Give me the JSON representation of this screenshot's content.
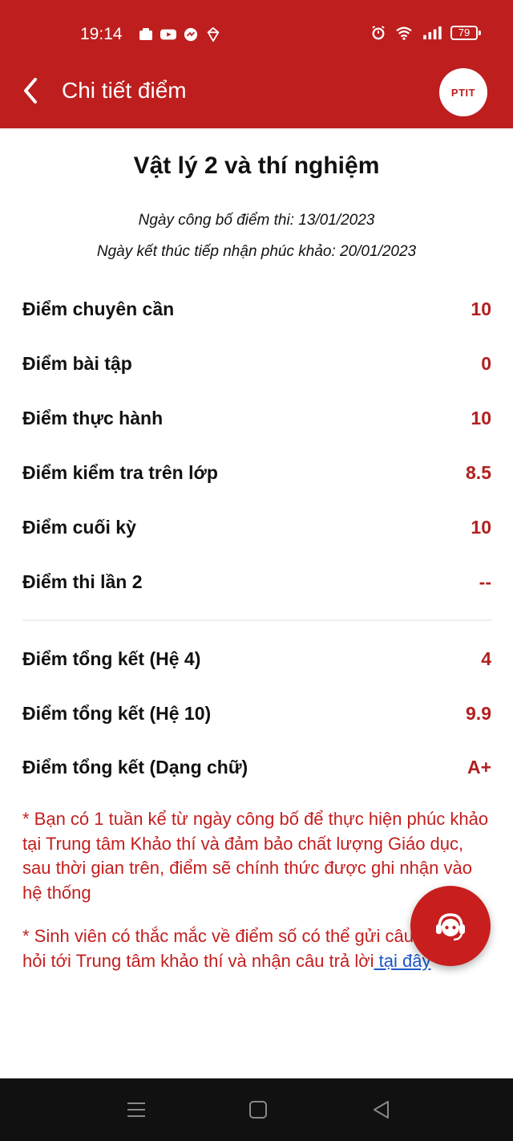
{
  "status_bar": {
    "time": "19:14",
    "left_icons": [
      "notification-icon",
      "youtube-icon",
      "messenger-icon",
      "app-icon"
    ],
    "right_icons": [
      "alarm-icon",
      "wifi-icon",
      "signal-icon"
    ],
    "battery": "79"
  },
  "header": {
    "title": "Chi tiết điểm",
    "logo_text": "PTIT",
    "background": "#be1e1e"
  },
  "subject": {
    "name": "Vật lý 2 và thí nghiệm",
    "announce_date": "Ngày công bố điểm thi: 13/01/2023",
    "appeal_end_date": "Ngày kết thúc tiếp nhận phúc khảo: 20/01/2023"
  },
  "scores": [
    {
      "label": "Điểm chuyên cần",
      "value": "10"
    },
    {
      "label": "Điểm bài tập",
      "value": "0"
    },
    {
      "label": "Điểm thực hành",
      "value": "10"
    },
    {
      "label": "Điểm kiểm tra trên lớp",
      "value": "8.5"
    },
    {
      "label": "Điểm cuối kỳ",
      "value": "10"
    },
    {
      "label": "Điểm thi lần 2",
      "value": "--"
    }
  ],
  "totals": [
    {
      "label": "Điểm tổng kết (Hệ 4)",
      "value": "4"
    },
    {
      "label": "Điểm tổng kết (Hệ 10)",
      "value": "9.9"
    },
    {
      "label": "Điểm tổng kết (Dạng chữ)",
      "value": "A+"
    }
  ],
  "notes": {
    "note1": "* Bạn có 1 tuần kể từ ngày công bố để thực hiện phúc khảo tại Trung tâm Khảo thí và đảm bảo chất lượng Giáo dục, sau thời gian trên, điểm sẽ chính thức được ghi nhận vào hệ thống",
    "note2_text": "* Sinh viên có thắc mắc về điểm số có thể gửi câu hỏi tới Trung tâm khảo thí và nhận câu trả lời",
    "note2_link": " tại đây"
  },
  "fab": {
    "icon": "support-chat-icon"
  },
  "colors": {
    "accent": "#be1e1e",
    "value_text": "#b21f1f",
    "link": "#1a56c8"
  }
}
